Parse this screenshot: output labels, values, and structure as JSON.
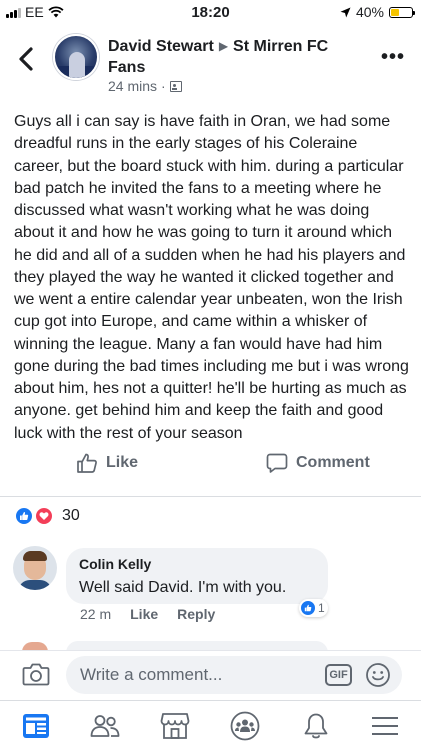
{
  "status_bar": {
    "carrier": "EE",
    "time": "18:20",
    "battery_percent": "40%",
    "battery_level": 0.4
  },
  "post": {
    "author": "David Stewart",
    "group": "St Mirren FC Fans",
    "time": "24 mins",
    "body": "Guys all i can say is have faith in Oran, we had some dreadful runs in  the early stages of his Coleraine career,  but the board stuck with him. during a particular bad patch he invited the fans to a meeting where he discussed what wasn't working what he was doing about it and how he was going to turn it around which he did and all of a sudden when he had his players and they played the way he wanted it clicked together and we went a entire calendar year unbeaten, won the Irish cup got into Europe, and came within a whisker of winning the league. Many a fan would have had him gone during the bad times including me but i was wrong about him, hes not a quitter! he'll be hurting as much as anyone. get behind him and keep the faith and good luck with the rest of your season"
  },
  "actions": {
    "like_label": "Like",
    "comment_label": "Comment"
  },
  "reactions": {
    "count": "30",
    "icons": [
      "like-reaction-icon",
      "love-reaction-icon"
    ]
  },
  "comments": [
    {
      "author": "Colin Kelly",
      "text": "Well said David. I'm with you.",
      "time": "22 m",
      "like_label": "Like",
      "reply_label": "Reply",
      "reaction_count": "1"
    }
  ],
  "composer": {
    "placeholder": "Write a comment...",
    "gif_label": "GIF"
  },
  "colors": {
    "accent": "#1877f2",
    "love": "#f33e58",
    "secondary_text": "#606770",
    "bubble": "#f0f2f5"
  },
  "tabbar": [
    "news-feed-icon",
    "friends-icon",
    "marketplace-icon",
    "groups-icon",
    "notifications-icon",
    "menu-icon"
  ]
}
